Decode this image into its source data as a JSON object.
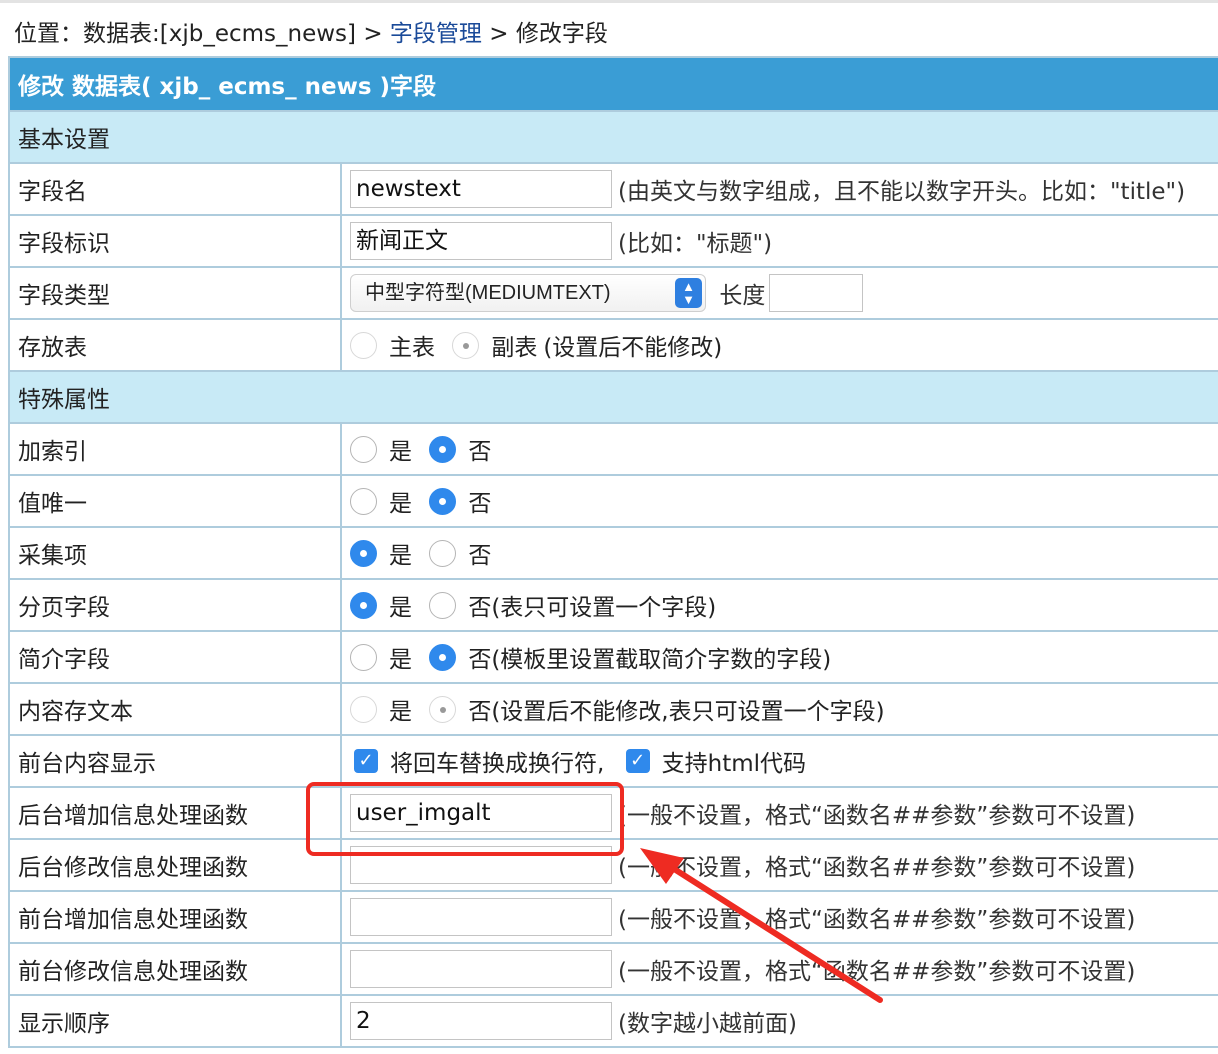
{
  "breadcrumb": {
    "prefix": "位置：",
    "table": "数据表:[xjb_ecms_news]",
    "sep1": " > ",
    "field_mgmt": "字段管理",
    "sep2": " > ",
    "current": "修改字段"
  },
  "form_title": "修改 数据表( xjb_ ecms_ news )字段",
  "sections": {
    "basic": "基本设置",
    "special": "特殊属性"
  },
  "fields": {
    "name": {
      "label": "字段名",
      "value": "newstext",
      "hint": "(由英文与数字组成，且不能以数字开头。比如：\"title\")"
    },
    "mark": {
      "label": "字段标识",
      "value": "新闻正文",
      "hint": "(比如：\"标题\")"
    },
    "type": {
      "label": "字段类型",
      "selected": "中型字符型(MEDIUMTEXT)",
      "length_label": "长度",
      "length_value": ""
    },
    "store": {
      "label": "存放表",
      "opt1": "主表",
      "opt2": "副表",
      "hint": "(设置后不能修改)",
      "selected": "副表",
      "disabled": true
    },
    "index": {
      "label": "加索引",
      "yes": "是",
      "no": "否",
      "selected": "否"
    },
    "unique": {
      "label": "值唯一",
      "yes": "是",
      "no": "否",
      "selected": "否"
    },
    "collect": {
      "label": "采集项",
      "yes": "是",
      "no": "否",
      "selected": "是"
    },
    "paging": {
      "label": "分页字段",
      "yes": "是",
      "no": "否(表只可设置一个字段)",
      "selected": "是"
    },
    "summary": {
      "label": "简介字段",
      "yes": "是",
      "no": "否(模板里设置截取简介字数的字段)",
      "selected": "否"
    },
    "textstore": {
      "label": "内容存文本",
      "yes": "是",
      "no": "否(设置后不能修改,表只可设置一个字段)",
      "selected": "否",
      "disabled": true
    },
    "display": {
      "label": "前台内容显示",
      "opt1": "将回车替换成换行符,",
      "opt2": "支持html代码",
      "opt1_checked": true,
      "opt2_checked": true
    },
    "admin_add_fn": {
      "label": "后台增加信息处理函数",
      "value": "user_imgalt",
      "hint": "(一般不设置，格式“函数名##参数”参数可不设置)"
    },
    "admin_edit_fn": {
      "label": "后台修改信息处理函数",
      "value": "",
      "hint": "(一般不设置，格式“函数名##参数”参数可不设置)"
    },
    "front_add_fn": {
      "label": "前台增加信息处理函数",
      "value": "",
      "hint": "(一般不设置，格式“函数名##参数”参数可不设置)"
    },
    "front_edit_fn": {
      "label": "前台修改信息处理函数",
      "value": "",
      "hint": "(一般不设置，格式“函数名##参数”参数可不设置)"
    },
    "order": {
      "label": "显示顺序",
      "value": "2",
      "hint": "(数字越小越前面)"
    }
  },
  "annotation": {
    "color": "#ee2b22",
    "type": "arrow-and-box"
  }
}
